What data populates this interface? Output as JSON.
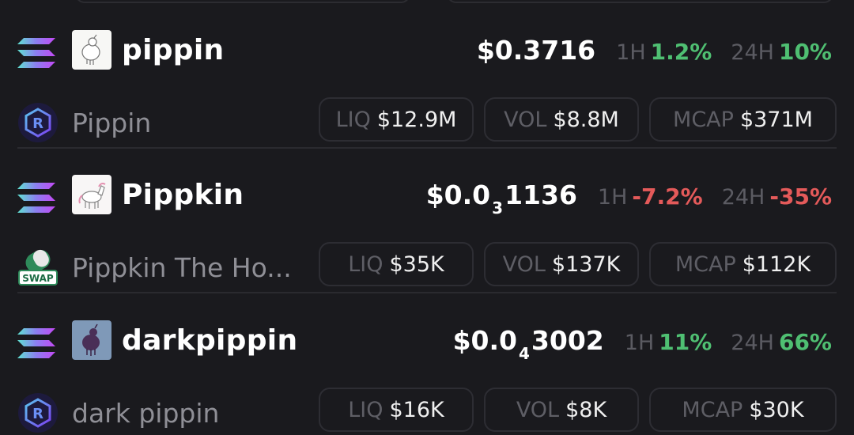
{
  "tokens": [
    {
      "symbol": "pippin",
      "name": "Pippin",
      "chain_icon": "solana-icon",
      "dex_icon": "raydium-icon",
      "price": {
        "prefix": "$0.3716",
        "sub": "",
        "suffix": ""
      },
      "h1_label": "1H",
      "h1_value": "1.2%",
      "h1_trend": "up",
      "h24_label": "24H",
      "h24_value": "10%",
      "h24_trend": "up",
      "liq_label": "LIQ",
      "liq_value": "$12.9M",
      "vol_label": "VOL",
      "vol_value": "$8.8M",
      "mcap_label": "MCAP",
      "mcap_value": "$371M"
    },
    {
      "symbol": "Pippkin",
      "name": "Pippkin The Ho...",
      "chain_icon": "solana-icon",
      "dex_icon": "swap-icon",
      "price": {
        "prefix": "$0.0",
        "sub": "3",
        "suffix": "1136"
      },
      "h1_label": "1H",
      "h1_value": "-7.2%",
      "h1_trend": "down",
      "h24_label": "24H",
      "h24_value": "-35%",
      "h24_trend": "down",
      "liq_label": "LIQ",
      "liq_value": "$35K",
      "vol_label": "VOL",
      "vol_value": "$137K",
      "mcap_label": "MCAP",
      "mcap_value": "$112K"
    },
    {
      "symbol": "darkpippin",
      "name": "dark pippin",
      "chain_icon": "solana-icon",
      "dex_icon": "raydium-icon",
      "price": {
        "prefix": "$0.0",
        "sub": "4",
        "suffix": "3002"
      },
      "h1_label": "1H",
      "h1_value": "11%",
      "h1_trend": "up",
      "h24_label": "24H",
      "h24_value": "66%",
      "h24_trend": "up",
      "liq_label": "LIQ",
      "liq_value": "$16K",
      "vol_label": "VOL",
      "vol_value": "$8K",
      "mcap_label": "MCAP",
      "mcap_value": "$30K"
    }
  ],
  "swap_badge": "SWAP",
  "colors": {
    "up": "#4fbf72",
    "down": "#e45a5a",
    "background": "#1a1a1e"
  }
}
